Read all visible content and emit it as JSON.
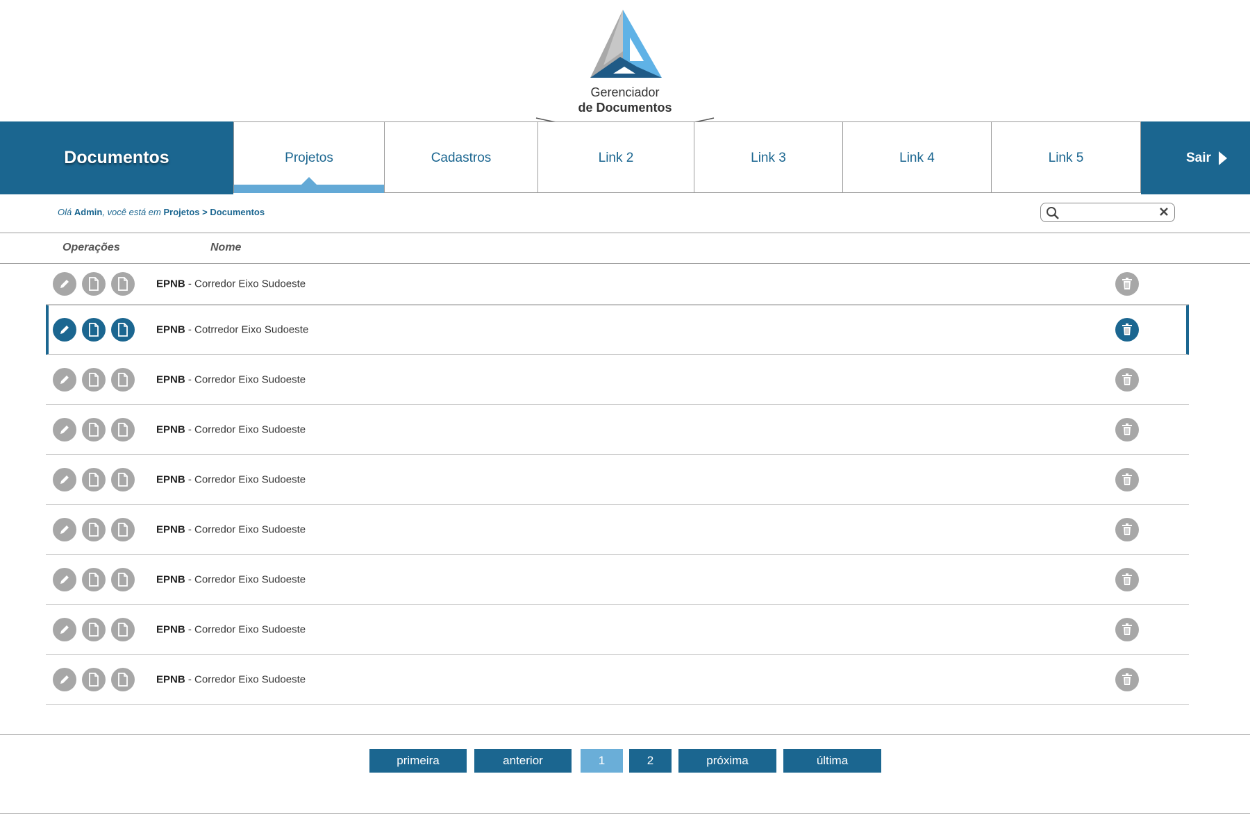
{
  "brand": {
    "line1": "Gerenciador",
    "line2": "de Documentos",
    "colors": {
      "primary": "#1b6690",
      "accent": "#63a9d6",
      "icon_gray": "#a7a7a7"
    }
  },
  "nav": {
    "title": "Documentos",
    "tabs": [
      "Projetos",
      "Cadastros",
      "Link 2",
      "Link 3",
      "Link 4",
      "Link 5"
    ],
    "active_tab": "Projetos",
    "exit_label": "Sair"
  },
  "breadcrumb": {
    "greeting": "Olá",
    "user": "Admin",
    "middle": ", você está em",
    "path1": "Projetos",
    "sep": ">",
    "path2": "Documentos"
  },
  "search": {
    "value": "",
    "placeholder": ""
  },
  "table": {
    "headers": {
      "ops": "Operações",
      "name": "Nome"
    },
    "rows": [
      {
        "code": "EPNB",
        "sep": " - ",
        "desc": "Corredor Eixo Sudoeste"
      },
      {
        "code": "EPNB",
        "sep": " - ",
        "desc": "Cotrredor Eixo Sudoeste",
        "selected": true
      },
      {
        "code": "EPNB",
        "sep": " - ",
        "desc": "Corredor Eixo Sudoeste"
      },
      {
        "code": "EPNB",
        "sep": " - ",
        "desc": "Corredor Eixo Sudoeste"
      },
      {
        "code": "EPNB",
        "sep": " - ",
        "desc": "Corredor Eixo Sudoeste"
      },
      {
        "code": "EPNB",
        "sep": " - ",
        "desc": "Corredor Eixo Sudoeste"
      },
      {
        "code": "EPNB",
        "sep": " - ",
        "desc": "Corredor Eixo Sudoeste"
      },
      {
        "code": "EPNB",
        "sep": " - ",
        "desc": "Corredor Eixo Sudoeste"
      },
      {
        "code": "EPNB",
        "sep": " - ",
        "desc": "Corredor Eixo Sudoeste"
      }
    ],
    "row_icons": [
      "pencil-icon",
      "document-icon",
      "document-icon",
      "trash-icon"
    ]
  },
  "pagination": {
    "first": "primeira",
    "prev": "anterior",
    "pages": [
      "1",
      "2"
    ],
    "current": "1",
    "next": "próxima",
    "last": "última"
  }
}
